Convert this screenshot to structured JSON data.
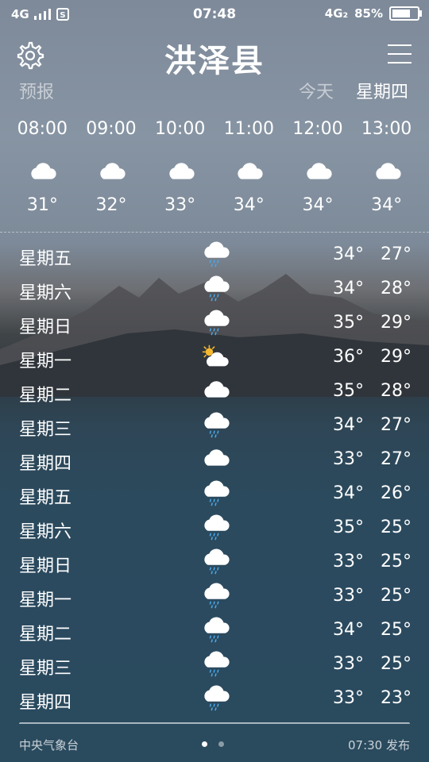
{
  "status_bar": {
    "left_network": "4G",
    "time": "07:48",
    "right_network": "4G₂",
    "battery_text": "85%",
    "battery_level": 0.85
  },
  "header": {
    "city": "洪泽县",
    "settings_icon": "gear-icon",
    "menu_icon": "hamburger-menu-icon"
  },
  "tabs": {
    "forecast": "预报",
    "today": "今天",
    "thursday": "星期四"
  },
  "hourly": [
    {
      "time": "08:00",
      "icon": "cloud",
      "temp": "31°"
    },
    {
      "time": "09:00",
      "icon": "cloud",
      "temp": "32°"
    },
    {
      "time": "10:00",
      "icon": "cloud",
      "temp": "33°"
    },
    {
      "time": "11:00",
      "icon": "cloud",
      "temp": "34°"
    },
    {
      "time": "12:00",
      "icon": "cloud",
      "temp": "34°"
    },
    {
      "time": "13:00",
      "icon": "cloud",
      "temp": "34°"
    }
  ],
  "daily": [
    {
      "day": "星期五",
      "icon": "rain",
      "high": "34°",
      "low": "27°"
    },
    {
      "day": "星期六",
      "icon": "rain",
      "high": "34°",
      "low": "28°"
    },
    {
      "day": "星期日",
      "icon": "rain",
      "high": "35°",
      "low": "29°"
    },
    {
      "day": "星期一",
      "icon": "partly-sunny",
      "high": "36°",
      "low": "29°"
    },
    {
      "day": "星期二",
      "icon": "cloud",
      "high": "35°",
      "low": "28°"
    },
    {
      "day": "星期三",
      "icon": "rain",
      "high": "34°",
      "low": "27°"
    },
    {
      "day": "星期四",
      "icon": "cloud",
      "high": "33°",
      "low": "27°"
    },
    {
      "day": "星期五",
      "icon": "rain",
      "high": "34°",
      "low": "26°"
    },
    {
      "day": "星期六",
      "icon": "rain",
      "high": "35°",
      "low": "25°"
    },
    {
      "day": "星期日",
      "icon": "rain",
      "high": "33°",
      "low": "25°"
    },
    {
      "day": "星期一",
      "icon": "rain",
      "high": "33°",
      "low": "25°"
    },
    {
      "day": "星期二",
      "icon": "rain",
      "high": "34°",
      "low": "25°"
    },
    {
      "day": "星期三",
      "icon": "rain",
      "high": "33°",
      "low": "25°"
    },
    {
      "day": "星期四",
      "icon": "rain",
      "high": "33°",
      "low": "23°"
    }
  ],
  "footer": {
    "source": "中央气象台",
    "published": "07:30 发布",
    "page_count": 2,
    "active_page": 0
  },
  "colors": {
    "sun": "#f5b82e",
    "cloud": "#ffffff",
    "rain": "#4aa8e8"
  }
}
